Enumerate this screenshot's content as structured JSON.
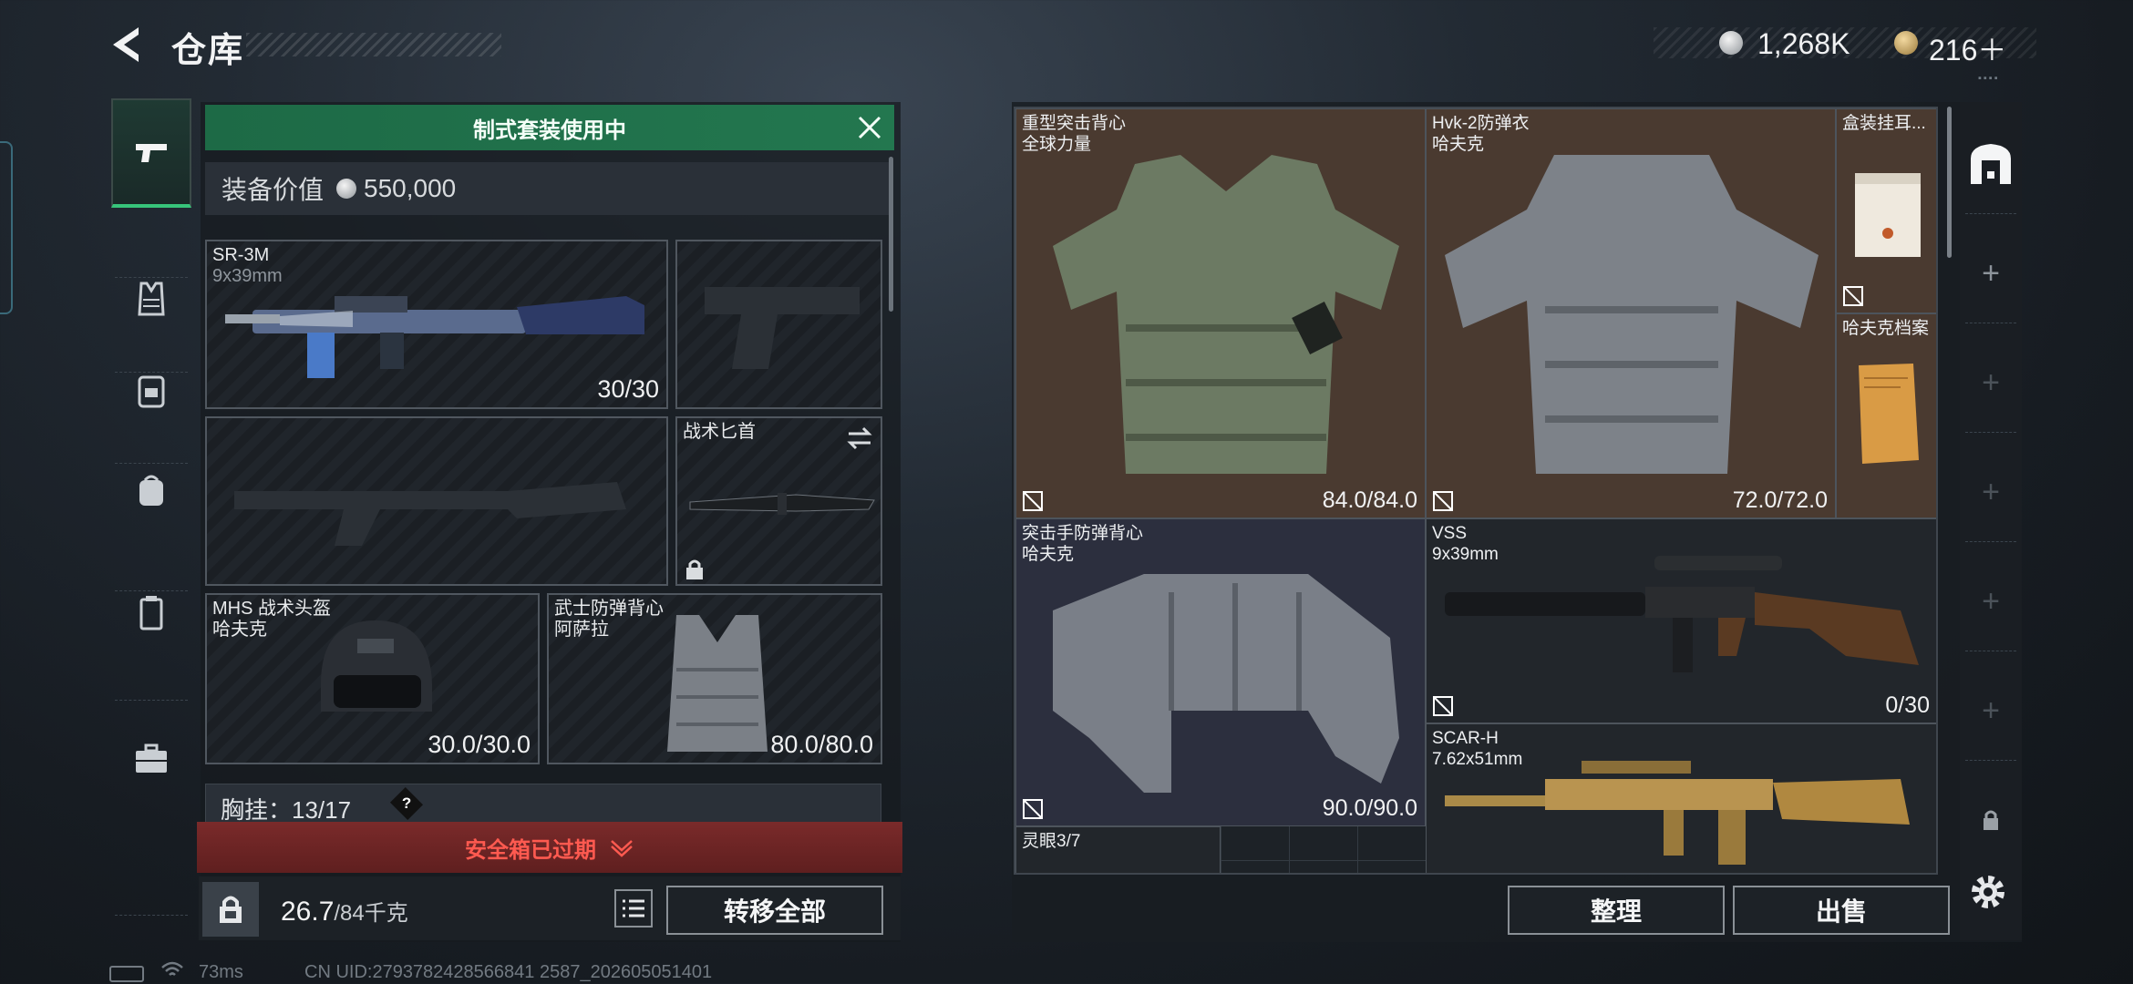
{
  "header": {
    "title": "仓库",
    "currency_silver": "1,268K",
    "currency_gold": "216＋"
  },
  "loadout": {
    "banner": "制式套装使用中",
    "value_label": "装备价值",
    "value": "550,000",
    "primary": {
      "name": "SR-3M",
      "ammo": "9x39mm",
      "durability": "30/30"
    },
    "knife": {
      "name": "战术匕首"
    },
    "helmet": {
      "name": "MHS 战术头盔",
      "brand": "哈夫克",
      "durability": "30.0/30.0"
    },
    "armor": {
      "name": "武士防弹背心",
      "brand": "阿萨拉",
      "durability": "80.0/80.0"
    },
    "chest_rig": {
      "label": "胸挂：",
      "capacity": "13/17",
      "help": "?"
    },
    "safe_box": "安全箱已过期",
    "weight": "26.7",
    "weight_max": "/84千克",
    "transfer_all": "转移全部"
  },
  "stash": {
    "items": [
      {
        "name": "重型突击背心",
        "brand": "全球力量",
        "durability": "84.0/84.0"
      },
      {
        "name": "Hvk-2防弹衣",
        "brand": "哈夫克",
        "durability": "72.0/72.0"
      },
      {
        "name": "盒装挂耳..."
      },
      {
        "name": "哈夫克档案"
      },
      {
        "name": "突击手防弹背心",
        "brand": "哈夫克",
        "durability": "90.0/90.0"
      },
      {
        "name": "VSS",
        "ammo": "9x39mm",
        "durability": "0/30"
      },
      {
        "name": "SCAR-H",
        "ammo": "7.62x51mm"
      },
      {
        "name": "灵眼3/7"
      }
    ],
    "sort_button": "整理",
    "sell_button": "出售"
  },
  "status_bar": {
    "ping": "73ms",
    "uid": "CN UID:2793782428566841 2587_202605051401"
  },
  "colors": {
    "accent_green": "#37c47a",
    "banner_green": "#1d6a46",
    "warning_red": "#ff5a50"
  }
}
